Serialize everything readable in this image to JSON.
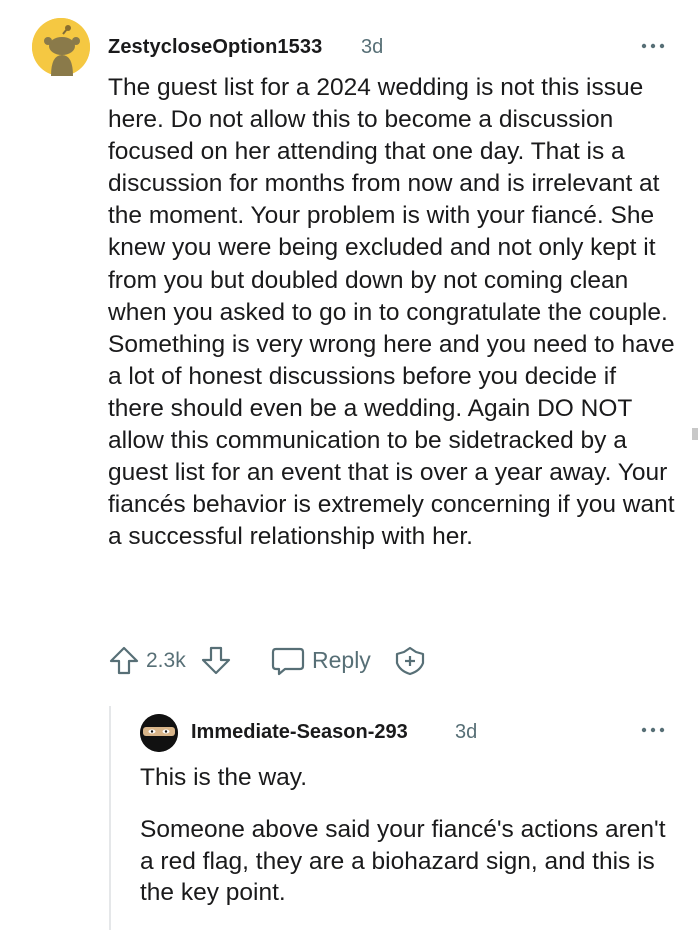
{
  "comment": {
    "username": "ZestycloseOption1533",
    "timestamp": "3d",
    "more_icon": "more-horizontal-icon",
    "body": "The guest list for a 2024 wedding is not this issue here. Do not allow this to become a discussion focused on her attending that one day. That is a discussion for months from now and is irrelevant at the moment. Your problem is with your fiancé. She knew you were being excluded and not only kept it from you but doubled down by not coming clean when you asked to go in to congratulate the couple. Something is very wrong here and you need to have a lot of honest discussions before you decide if there should even be a wedding. Again DO NOT allow this communication to be sidetracked by a guest list for an event that is over a year away. Your fiancés behavior is extremely concerning if you want a successful relationship with her.",
    "score": "2.3k",
    "reply_label": "Reply",
    "avatar_color": "#f5c842"
  },
  "reply": {
    "username": "Immediate-Season-293",
    "timestamp": "3d",
    "paragraphs": [
      "This is the way.",
      "Someone above said your fiancé's actions aren't a red flag, they are a biohazard sign, and this is the key point."
    ]
  },
  "colors": {
    "text": "#1a1a1b",
    "meta": "#576f76",
    "thread_line": "#e5e7e9"
  }
}
